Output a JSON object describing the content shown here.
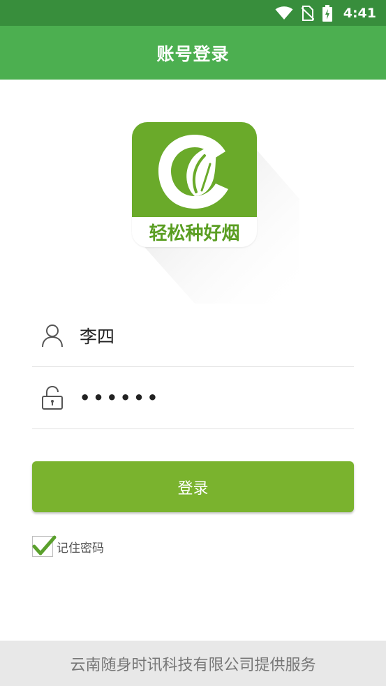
{
  "status_bar": {
    "time": "4:41",
    "icons": [
      "wifi-icon",
      "no-sim-icon",
      "battery-charging-icon"
    ],
    "background": "#388e3c"
  },
  "app_bar": {
    "title": "账号登录",
    "background": "#4caf50"
  },
  "logo": {
    "text": "轻松种好烟",
    "icon": "leaf-logo-icon",
    "color": "#6aaa2a"
  },
  "form": {
    "username": {
      "icon": "user-icon",
      "value": "李四"
    },
    "password": {
      "icon": "lock-icon",
      "value": "••••••"
    }
  },
  "login_button": {
    "label": "登录",
    "color": "#7ab32e"
  },
  "remember": {
    "label": "记住密码",
    "checked": true,
    "check_color": "#5aa02c"
  },
  "footer": {
    "text": "云南随身时讯科技有限公司提供服务"
  }
}
